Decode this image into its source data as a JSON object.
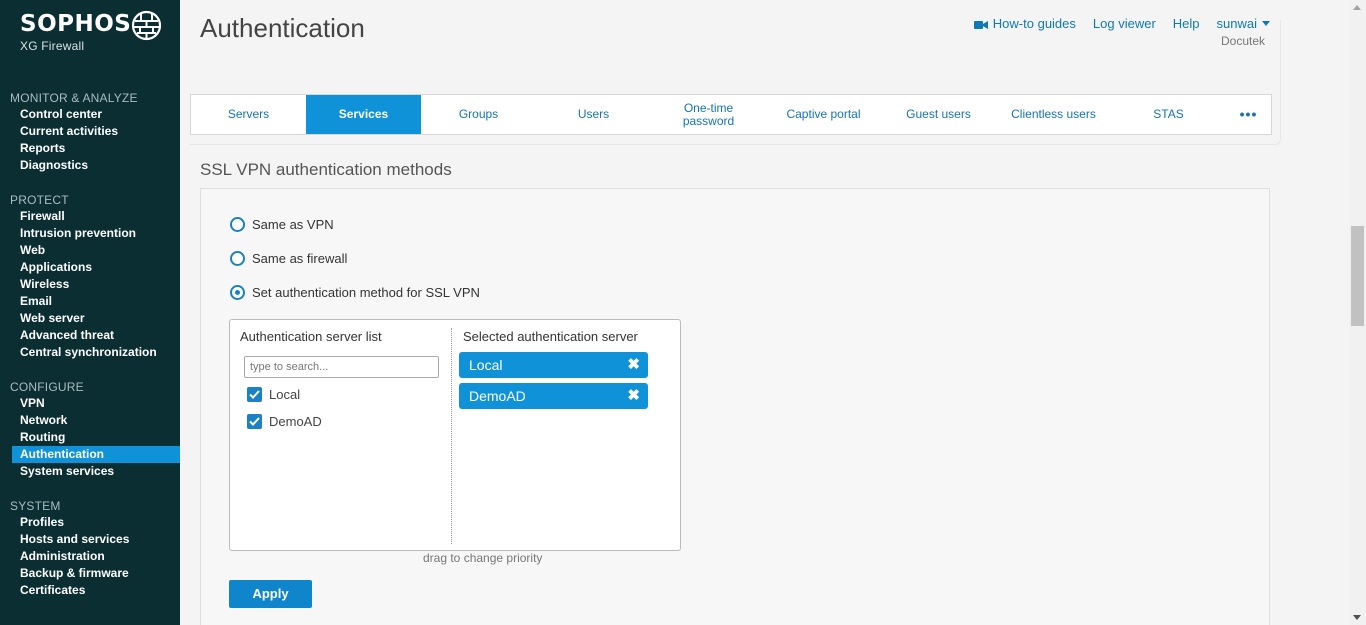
{
  "brand": {
    "name": "SOPHOS",
    "product": "XG Firewall",
    "icon": "globe-icon"
  },
  "sidebar": {
    "sections": [
      {
        "heading": "MONITOR & ANALYZE",
        "items": [
          "Control center",
          "Current activities",
          "Reports",
          "Diagnostics"
        ]
      },
      {
        "heading": "PROTECT",
        "items": [
          "Firewall",
          "Intrusion prevention",
          "Web",
          "Applications",
          "Wireless",
          "Email",
          "Web server",
          "Advanced threat",
          "Central synchronization"
        ]
      },
      {
        "heading": "CONFIGURE",
        "items": [
          "VPN",
          "Network",
          "Routing",
          "Authentication",
          "System services"
        ]
      },
      {
        "heading": "SYSTEM",
        "items": [
          "Profiles",
          "Hosts and services",
          "Administration",
          "Backup & firmware",
          "Certificates"
        ]
      }
    ],
    "active": "Authentication"
  },
  "header": {
    "title": "Authentication",
    "links": {
      "howto": "How-to guides",
      "logviewer": "Log viewer",
      "help": "Help",
      "user": "sunwai"
    },
    "user_org": "Docutek"
  },
  "tabs": [
    "Servers",
    "Services",
    "Groups",
    "Users",
    "One-time password",
    "Captive portal",
    "Guest users",
    "Clientless users",
    "STAS",
    "•••"
  ],
  "active_tab": "Services",
  "section": {
    "title": "SSL VPN authentication methods",
    "options": [
      "Same as VPN",
      "Same as firewall",
      "Set authentication method for SSL VPN"
    ],
    "selected_option": "Set authentication method for SSL VPN",
    "server_list_title": "Authentication server list",
    "search_placeholder": "type to search...",
    "servers": [
      {
        "label": "Local",
        "checked": true
      },
      {
        "label": "DemoAD",
        "checked": true
      }
    ],
    "selected_title": "Selected authentication server",
    "selected": [
      "Local",
      "DemoAD"
    ],
    "remove_icon": "close-x-icon",
    "hint": "drag to change priority",
    "apply": "Apply"
  },
  "colors": {
    "sidebar_bg": "#0b2e33",
    "accent": "#0f92d8",
    "link": "#0f79b8"
  }
}
